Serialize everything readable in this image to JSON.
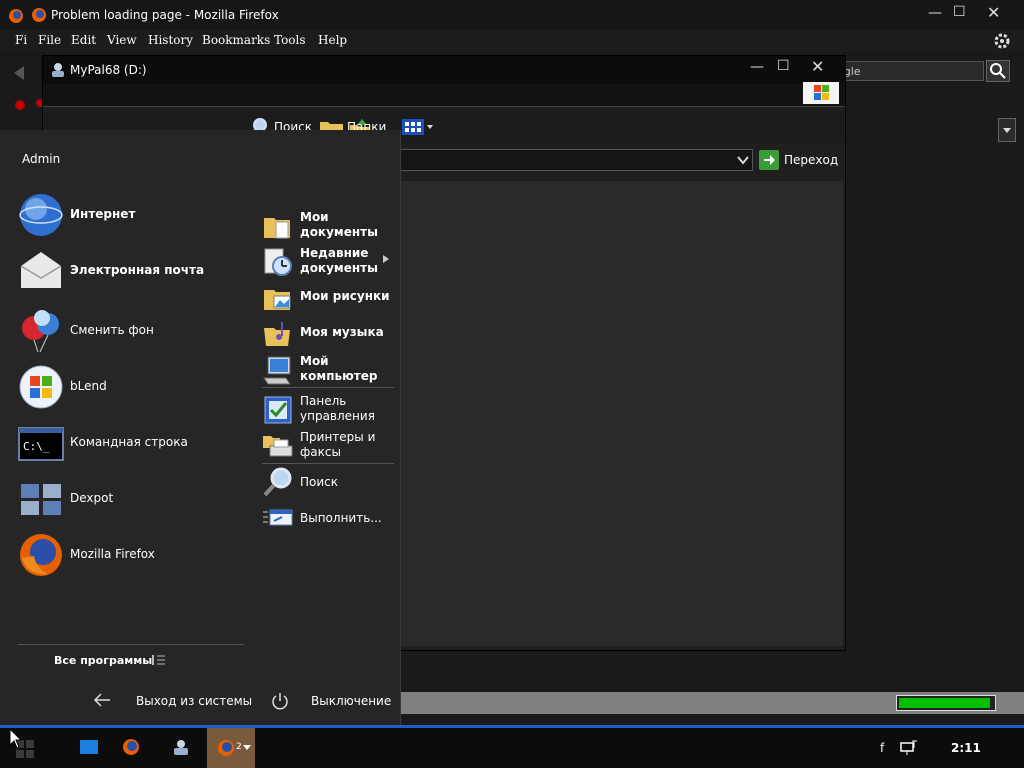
{
  "firefox": {
    "title": "Problem loading page - Mozilla Firefox",
    "menu_hidden_letter": "Fi",
    "menu": [
      "File",
      "Edit",
      "View",
      "History",
      "Bookmarks",
      "Tools",
      "Help"
    ],
    "search_placeholder": "ogle",
    "progress_fraction": 0.97
  },
  "explorer": {
    "title": "MyPal68 (D:)",
    "toolbar": {
      "search_label": "Поиск",
      "folders_label": "Папки"
    },
    "go_label": "Переход"
  },
  "start_menu": {
    "user": "Admin",
    "pinned": [
      {
        "label": "Интернет",
        "bold": true,
        "icon": "globe-icon"
      },
      {
        "label": "Электронная почта",
        "bold": true,
        "icon": "envelope-icon"
      },
      {
        "label": "Сменить фон",
        "bold": false,
        "icon": "balloons-icon"
      },
      {
        "label": "bLend",
        "bold": false,
        "icon": "windows-logo-icon"
      },
      {
        "label": "Командная строка",
        "bold": false,
        "icon": "command-prompt-icon"
      },
      {
        "label": "Dexpot",
        "bold": false,
        "icon": "desktops-icon"
      },
      {
        "label": "Mozilla Firefox",
        "bold": false,
        "icon": "firefox-icon"
      }
    ],
    "places": [
      {
        "label": "Мои документы",
        "bold": true,
        "icon": "documents-folder-icon"
      },
      {
        "label": "Недавние документы",
        "bold": true,
        "icon": "recent-documents-icon",
        "has_submenu": true
      },
      {
        "label": "Мои рисунки",
        "bold": true,
        "icon": "pictures-folder-icon"
      },
      {
        "label": "Моя музыка",
        "bold": true,
        "icon": "music-folder-icon"
      },
      {
        "label": "Мой компьютер",
        "bold": true,
        "icon": "computer-icon"
      },
      {
        "label": "Панель управления",
        "bold": false,
        "icon": "control-panel-icon"
      },
      {
        "label": "Принтеры и факсы",
        "bold": false,
        "icon": "printer-icon"
      },
      {
        "label": "Поиск",
        "bold": false,
        "icon": "search-magnifier-icon"
      },
      {
        "label": "Выполнить...",
        "bold": false,
        "icon": "run-icon"
      }
    ],
    "all_programs": "Все программы",
    "log_off": "Выход из системы",
    "shut_down": "Выключение"
  },
  "taskbar": {
    "firefox_group_count": "2",
    "tray_letter": "f",
    "clock": "2:11"
  }
}
